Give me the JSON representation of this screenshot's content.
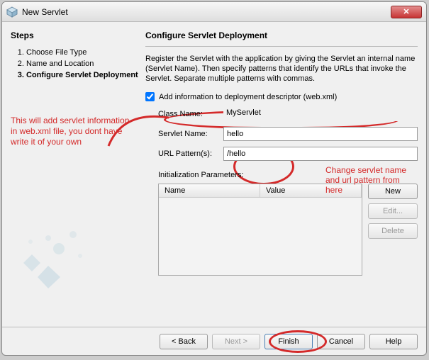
{
  "window": {
    "title": "New Servlet",
    "close_label": "✕"
  },
  "steps": {
    "heading": "Steps",
    "items": [
      {
        "label": "Choose File Type",
        "active": false
      },
      {
        "label": "Name and Location",
        "active": false
      },
      {
        "label": "Configure Servlet Deployment",
        "active": true
      }
    ]
  },
  "main": {
    "heading": "Configure Servlet Deployment",
    "description": "Register the Servlet with the application by giving the Servlet an internal name (Servlet Name). Then specify patterns that identify the URLs that invoke the Servlet. Separate multiple patterns with commas.",
    "checkbox_label": "Add information to deployment descriptor (web.xml)",
    "checkbox_checked": true,
    "fields": {
      "class_label": "Class Name:",
      "class_value": "MyServlet",
      "servlet_label": "Servlet Name:",
      "servlet_value": "hello",
      "url_label": "URL Pattern(s):",
      "url_value": "/hello"
    },
    "init_label": "Initialization Parameters:",
    "table": {
      "col_name": "Name",
      "col_value": "Value"
    },
    "side_buttons": {
      "new": "New",
      "edit": "Edit...",
      "delete": "Delete"
    }
  },
  "annotations": {
    "left": "This will add servlet information in web.xml file, you dont have write it of your own",
    "right": "Change servlet name and url pattern from here"
  },
  "buttons": {
    "back": "< Back",
    "next": "Next >",
    "finish": "Finish",
    "cancel": "Cancel",
    "help": "Help"
  }
}
